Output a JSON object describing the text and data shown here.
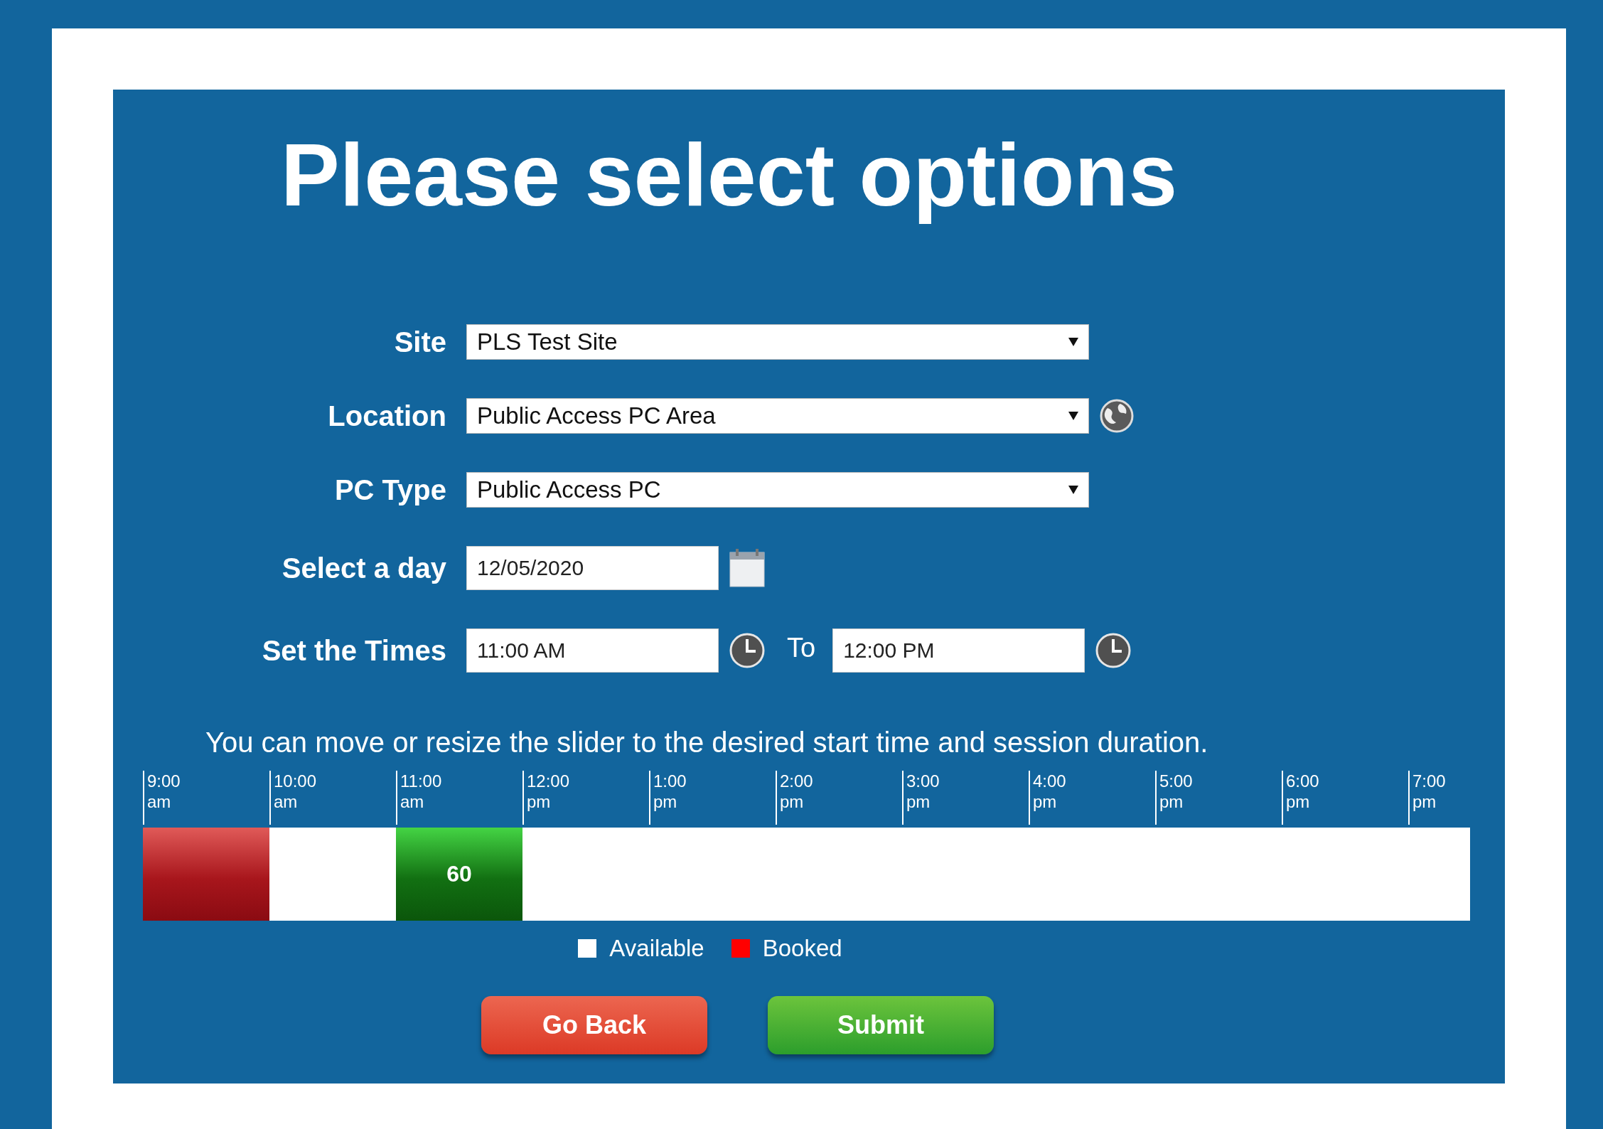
{
  "title": "Please select options",
  "fields": [
    {
      "kind": "select",
      "label": "Site",
      "value": "PLS Test Site"
    },
    {
      "kind": "select",
      "label": "Location",
      "value": "Public Access PC Area",
      "globe": true
    },
    {
      "kind": "select",
      "label": "PC Type",
      "value": "Public Access PC"
    },
    {
      "kind": "date",
      "label": "Select a day",
      "value": "12/05/2020"
    },
    {
      "kind": "times",
      "label": "Set the Times",
      "value": "11:00 AM",
      "separator": "To",
      "end_value": "12:00 PM"
    }
  ],
  "instruction": "You can move or resize the slider to the desired start time and session duration.",
  "timeline": [
    {
      "time": "9:00",
      "period": "am",
      "booked": true,
      "selected": false
    },
    {
      "time": "10:00",
      "period": "am",
      "booked": false,
      "selected": false
    },
    {
      "time": "11:00",
      "period": "am",
      "booked": false,
      "selected": true,
      "label": "60"
    },
    {
      "time": "12:00",
      "period": "pm",
      "booked": false,
      "selected": false
    },
    {
      "time": "1:00",
      "period": "pm",
      "booked": false,
      "selected": false
    },
    {
      "time": "2:00",
      "period": "pm",
      "booked": false,
      "selected": false
    },
    {
      "time": "3:00",
      "period": "pm",
      "booked": false,
      "selected": false
    },
    {
      "time": "4:00",
      "period": "pm",
      "booked": false,
      "selected": false
    },
    {
      "time": "5:00",
      "period": "pm",
      "booked": false,
      "selected": false
    },
    {
      "time": "6:00",
      "period": "pm",
      "booked": false,
      "selected": false
    },
    {
      "time": "7:00",
      "period": "pm",
      "booked": false,
      "selected": false
    }
  ],
  "legend": [
    {
      "label": "Available",
      "color": "#ffffff"
    },
    {
      "label": "Booked",
      "color": "#ff0000"
    }
  ],
  "buttons": [
    {
      "kind": "back",
      "label": "Go Back"
    },
    {
      "kind": "submit",
      "label": "Submit"
    }
  ]
}
